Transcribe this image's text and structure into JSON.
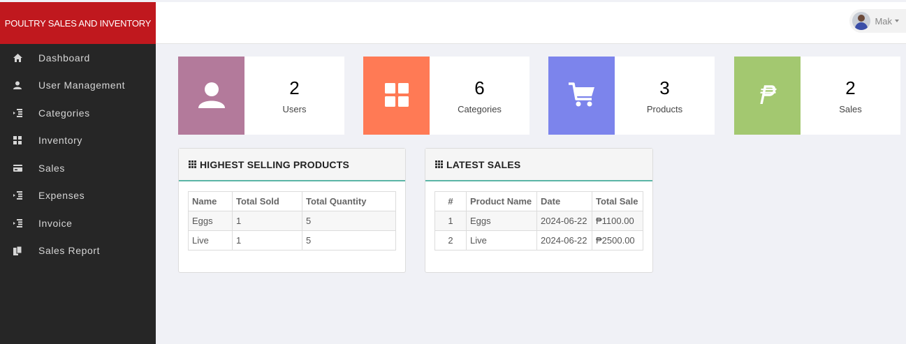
{
  "brand": {
    "title": "POULTRY SALES AND INVENTORY"
  },
  "user": {
    "name": "Mak"
  },
  "sidebar": {
    "items": [
      {
        "label": "Dashboard",
        "icon": "home-icon"
      },
      {
        "label": "User Management",
        "icon": "user-icon"
      },
      {
        "label": "Categories",
        "icon": "list-indent-icon"
      },
      {
        "label": "Inventory",
        "icon": "grid-icon"
      },
      {
        "label": "Sales",
        "icon": "credit-card-icon"
      },
      {
        "label": "Expenses",
        "icon": "list-indent-icon"
      },
      {
        "label": "Invoice",
        "icon": "list-indent-icon"
      },
      {
        "label": "Sales Report",
        "icon": "duplicate-icon"
      }
    ]
  },
  "stats": [
    {
      "value": "2",
      "label": "Users",
      "color": "#b37a9b",
      "icon": "user-icon"
    },
    {
      "value": "6",
      "label": "Categories",
      "color": "#ff7a55",
      "icon": "grid-icon"
    },
    {
      "value": "3",
      "label": "Products",
      "color": "#7c84ec",
      "icon": "cart-icon"
    },
    {
      "value": "2",
      "label": "Sales",
      "color": "#a3c870",
      "icon": "peso-icon"
    }
  ],
  "highest_selling": {
    "title": "HIGHEST SELLING PRODUCTS",
    "columns": [
      "Name",
      "Total Sold",
      "Total Quantity"
    ],
    "rows": [
      [
        "Eggs",
        "1",
        "5"
      ],
      [
        "Live",
        "1",
        "5"
      ]
    ]
  },
  "latest_sales": {
    "title": "LATEST SALES",
    "columns": [
      "#",
      "Product Name",
      "Date",
      "Total Sale"
    ],
    "rows": [
      [
        "1",
        "Eggs",
        "2024-06-22",
        "₱1100.00"
      ],
      [
        "2",
        "Live",
        "2024-06-22",
        "₱2500.00"
      ]
    ]
  }
}
